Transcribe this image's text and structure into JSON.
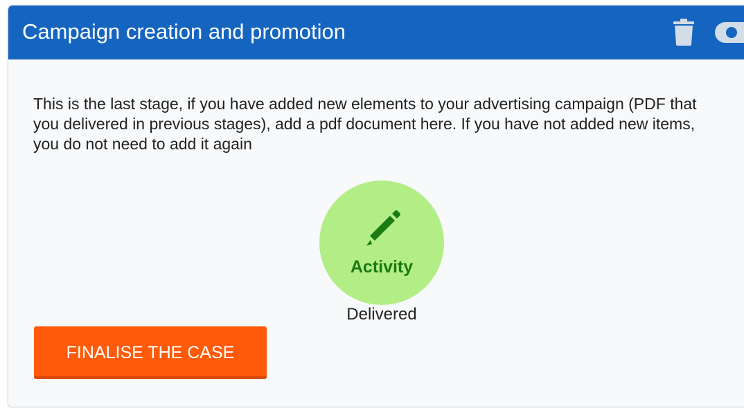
{
  "card": {
    "title": "Campaign creation and promotion",
    "description": "This is the last stage, if you have added new elements to your advertising campaign (PDF that you delivered in previous stages), add a pdf document here. If you have not added new items, you do not need to add it again"
  },
  "activity": {
    "label": "Activity",
    "status": "Delivered",
    "icon": "pencil-icon"
  },
  "actions": {
    "finalise_label": "FINALISE THE CASE"
  },
  "icons": {
    "header_actions": [
      "trash-icon",
      "toggle-icon"
    ]
  },
  "colors": {
    "header": "#1565c0",
    "activity_circle": "#b2ee85",
    "activity_text": "#1b7a12",
    "finalise_button": "#ff5a0a"
  }
}
